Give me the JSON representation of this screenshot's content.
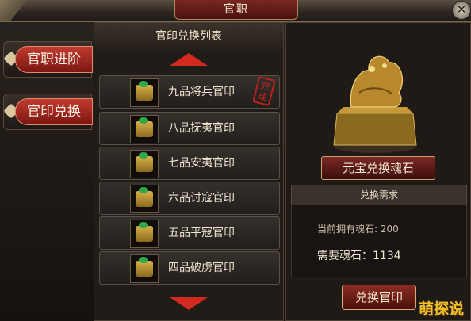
{
  "window": {
    "title": "官职"
  },
  "tabs": [
    {
      "label": "官职进阶",
      "active": false
    },
    {
      "label": "官印兑换",
      "active": true
    }
  ],
  "list": {
    "header": "官印兑换列表",
    "items": [
      {
        "label": "九品将兵官印",
        "stamp": "完成"
      },
      {
        "label": "八品抚夷官印"
      },
      {
        "label": "七品安夷官印"
      },
      {
        "label": "六品讨寇官印"
      },
      {
        "label": "五品平寇官印"
      },
      {
        "label": "四品破虏官印"
      }
    ]
  },
  "detail": {
    "convert_label": "元宝兑换魂石",
    "requirement_header": "兑换需求",
    "owned_label": "当前拥有魂石: 200",
    "need_label": "需要魂石：1134",
    "exchange_button": "兑换官印"
  },
  "watermark": "萌探说",
  "colors": {
    "accent_red": "#d22a1e",
    "gold": "#d9b04a"
  }
}
